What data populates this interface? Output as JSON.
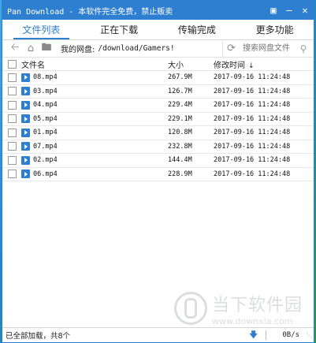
{
  "window": {
    "title": "Pan Download - 本软件完全免费，禁止贩卖",
    "icons": [
      "restore-icon",
      "minimize-icon",
      "close-icon"
    ]
  },
  "tabs": [
    {
      "label": "文件列表",
      "active": true
    },
    {
      "label": "正在下载",
      "active": false
    },
    {
      "label": "传输完成",
      "active": false
    },
    {
      "label": "更多功能",
      "active": false
    }
  ],
  "pathbar": {
    "label": "我的网盘:",
    "path": "/download/Gamers!",
    "search_placeholder": "搜索网盘文件"
  },
  "table": {
    "headers": {
      "name": "文件名",
      "size": "大小",
      "time": "修改时间"
    },
    "rows": [
      {
        "name": "08.mp4",
        "size": "267.9M",
        "time": "2017-09-16 11:24:48"
      },
      {
        "name": "03.mp4",
        "size": "126.7M",
        "time": "2017-09-16 11:24:48"
      },
      {
        "name": "04.mp4",
        "size": "229.4M",
        "time": "2017-09-16 11:24:48"
      },
      {
        "name": "05.mp4",
        "size": "229.1M",
        "time": "2017-09-16 11:24:48"
      },
      {
        "name": "01.mp4",
        "size": "120.8M",
        "time": "2017-09-16 11:24:48"
      },
      {
        "name": "07.mp4",
        "size": "232.8M",
        "time": "2017-09-16 11:24:48"
      },
      {
        "name": "02.mp4",
        "size": "144.4M",
        "time": "2017-09-16 11:24:48"
      },
      {
        "name": "06.mp4",
        "size": "228.9M",
        "time": "2017-09-16 11:24:48"
      }
    ]
  },
  "watermark": {
    "cn": "当下软件园",
    "url": "www.downxia.com"
  },
  "status": {
    "text": "已全部加载，共8个",
    "speed": "0B/s"
  },
  "colors": {
    "accent": "#2f7fd0"
  }
}
